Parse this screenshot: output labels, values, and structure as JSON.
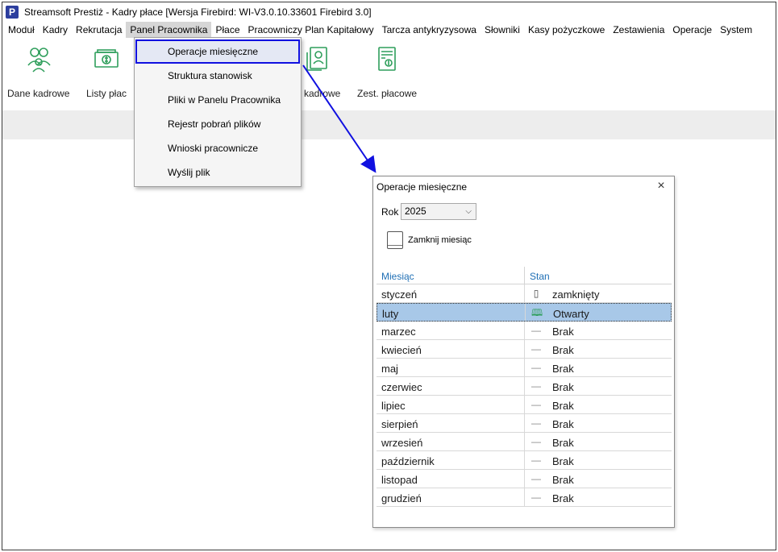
{
  "window": {
    "logo_letter": "P",
    "title": "Streamsoft Prestiż - Kadry płace [Wersja Firebird: WI-V3.0.10.33601 Firebird 3.0]"
  },
  "menu": [
    {
      "label": "Moduł"
    },
    {
      "label": "Kadry"
    },
    {
      "label": "Rekrutacja"
    },
    {
      "label": "Panel Pracownika",
      "open": true
    },
    {
      "label": "Płace"
    },
    {
      "label": "Pracowniczy Plan Kapitałowy"
    },
    {
      "label": "Tarcza antykryzysowa"
    },
    {
      "label": "Słowniki"
    },
    {
      "label": "Kasy pożyczkowe"
    },
    {
      "label": "Zestawienia"
    },
    {
      "label": "Operacje"
    },
    {
      "label": "System"
    }
  ],
  "ribbon": {
    "buttons": [
      {
        "label": "Dane kadrowe",
        "icon": "people-icon"
      },
      {
        "label": "Listy płac",
        "icon": "money-icon"
      },
      {
        "label": "t. kadrowe",
        "icon": "id-card-icon"
      },
      {
        "label": "Zest. płacowe",
        "icon": "payroll-report-icon"
      }
    ]
  },
  "dropdown": {
    "items": [
      {
        "label": "Operacje miesięczne",
        "highlighted": true
      },
      {
        "label": "Struktura stanowisk"
      },
      {
        "label": "Pliki w Panelu Pracownika"
      },
      {
        "label": "Rejestr pobrań plików"
      },
      {
        "label": "Wnioski pracownicze"
      },
      {
        "label": "Wyślij plik"
      }
    ]
  },
  "dialog": {
    "title": "Operacje miesięczne",
    "close_icon": "×",
    "year_label": "Rok",
    "year_value": "2025",
    "chevron": "⌵",
    "close_month_label": "Zamknij miesiąc",
    "columns": {
      "month": "Miesiąc",
      "state": "Stan"
    },
    "rows": [
      {
        "month": "styczeń",
        "state": "zamknięty",
        "icon": "closed-book-icon"
      },
      {
        "month": "luty",
        "state": "Otwarty",
        "icon": "open-book-icon",
        "selected": true
      },
      {
        "month": "marzec",
        "state": "Brak",
        "icon": "dash-icon"
      },
      {
        "month": "kwiecień",
        "state": "Brak",
        "icon": "dash-icon"
      },
      {
        "month": "maj",
        "state": "Brak",
        "icon": "dash-icon"
      },
      {
        "month": "czerwiec",
        "state": "Brak",
        "icon": "dash-icon"
      },
      {
        "month": "lipiec",
        "state": "Brak",
        "icon": "dash-icon"
      },
      {
        "month": "sierpień",
        "state": "Brak",
        "icon": "dash-icon"
      },
      {
        "month": "wrzesień",
        "state": "Brak",
        "icon": "dash-icon"
      },
      {
        "month": "październik",
        "state": "Brak",
        "icon": "dash-icon"
      },
      {
        "month": "listopad",
        "state": "Brak",
        "icon": "dash-icon"
      },
      {
        "month": "grudzień",
        "state": "Brak",
        "icon": "dash-icon"
      }
    ]
  },
  "colors": {
    "accent_green": "#2e9e5b",
    "highlight_blue": "#1010e0",
    "header_blue": "#1f6fb5",
    "selected_row": "#a8c8e8"
  }
}
